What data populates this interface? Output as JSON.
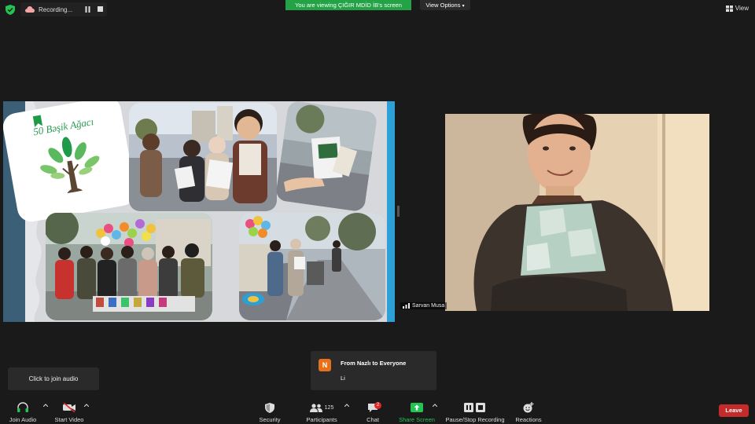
{
  "top_bar": {
    "recording_label": "Recording...",
    "viewing_banner": "You are viewing ÇIĞIR MDİD İB's screen",
    "view_options_label": "View Options",
    "view_label": "View"
  },
  "shared_screen": {
    "logo_text": "50 Bəşik Ağacı"
  },
  "participant_video": {
    "name": "Sarvan Musa"
  },
  "audio_tooltip": {
    "text": "Click to join audio"
  },
  "chat_popup": {
    "avatar_letter": "N",
    "from": "From Nazlı to Everyone",
    "message": "Li"
  },
  "toolbar": {
    "join_audio": "Join Audio",
    "start_video": "Start Video",
    "security": "Security",
    "participants": "Participants",
    "participants_count": "125",
    "chat": "Chat",
    "chat_badge": "2",
    "share_screen": "Share Screen",
    "pause_stop_recording": "Pause/Stop Recording",
    "reactions": "Reactions",
    "leave": "Leave"
  },
  "colors": {
    "share_green": "#23a345",
    "leave_red": "#c42b2b",
    "toolbar_bg": "#1a1a1a",
    "slide_blue": "#2ea0d8",
    "slide_dark_band": "#3c5f78"
  },
  "icons": {
    "encryption": "shield-check-icon",
    "recording": "cloud-icon",
    "audio": "headphones-icon",
    "video": "video-off-icon",
    "security": "shield-icon",
    "participants": "people-icon",
    "chat": "chat-bubble-icon",
    "share": "share-arrow-icon",
    "recording_control": "pause-stop-icon",
    "reactions": "smiley-plus-icon",
    "view": "grid-icon"
  }
}
